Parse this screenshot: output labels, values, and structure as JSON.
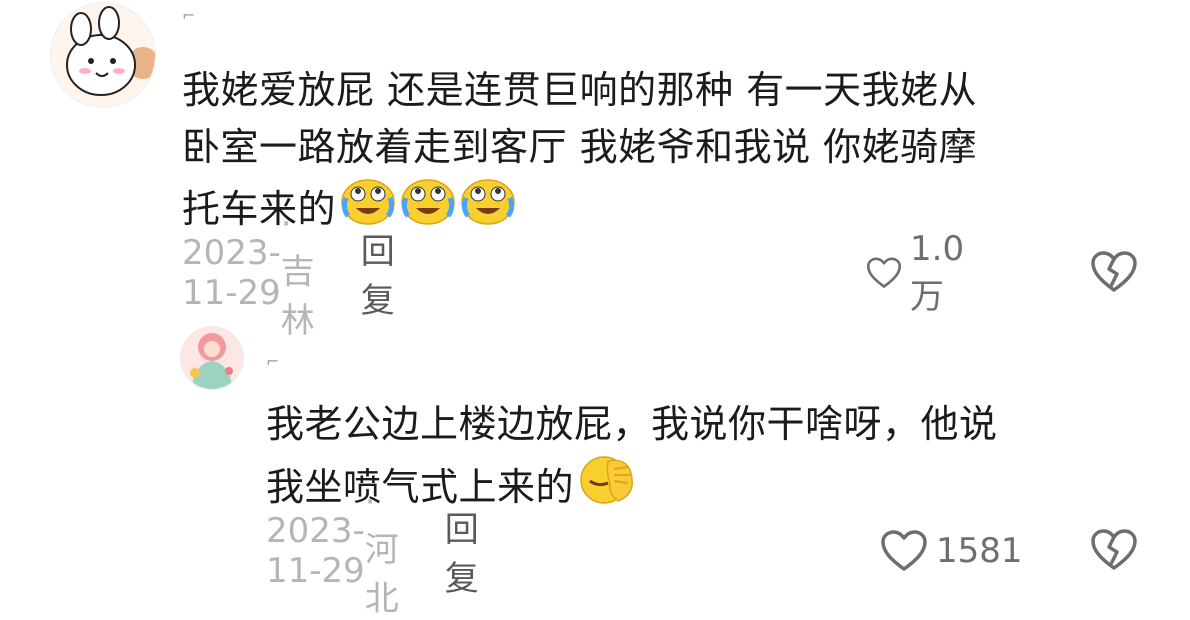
{
  "comments": [
    {
      "username": "⌐",
      "text_lines": [
        "我姥爱放屁 还是连贯巨响的那种 有一天我姥从",
        "卧室一路放着走到客厅 我姥爷和我说 你姥骑摩",
        "托车来的"
      ],
      "emojis": [
        "crying-laughing",
        "crying-laughing",
        "crying-laughing"
      ],
      "date": "2023-11-29",
      "location": "· 吉林",
      "reply_label": "回复",
      "likes": "1.0万"
    },
    {
      "username": "⌐",
      "text_lines": [
        "我老公边上楼边放屁，我说你干啥呀，他说",
        "我坐喷气式上来的"
      ],
      "emojis": [
        "facepalm"
      ],
      "date": "2023-11-29",
      "location": "· 河北",
      "reply_label": "回复",
      "likes": "1581"
    }
  ],
  "colors": {
    "meta": "#b5b5b5",
    "icon": "#6e6e6e",
    "text": "#1b1b1b"
  }
}
